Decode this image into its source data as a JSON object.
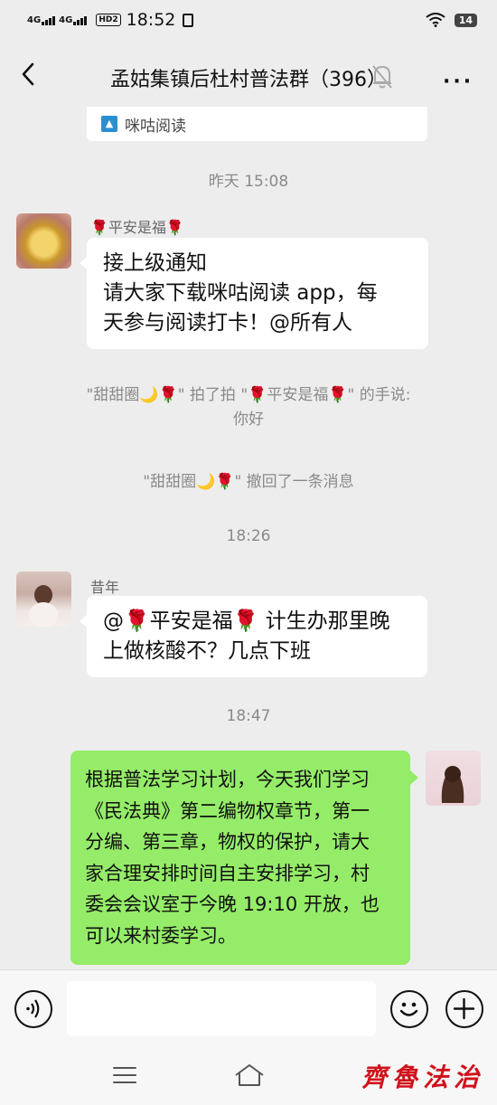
{
  "status_bar": {
    "signal1": "4G",
    "signal2": "4G",
    "hd": "HD2",
    "time": "18:52",
    "battery": "14"
  },
  "header": {
    "title": "孟姑集镇后杜村普法群（396）",
    "more": "···"
  },
  "shared_card": {
    "app_name": "咪咕阅读"
  },
  "timestamps": [
    "昨天 15:08",
    "18:26",
    "18:47"
  ],
  "messages": [
    {
      "sender": "🌹平安是福🌹",
      "text_lines": [
        "接上级通知",
        "请大家下载咪咕阅读 app，每",
        "天参与阅读打卡！@所有人"
      ]
    },
    {
      "sender": "昔年",
      "text_lines": [
        "@🌹平安是福🌹 计生办那里晚",
        "上做核酸不？几点下班"
      ]
    },
    {
      "sender": "me",
      "text_lines": [
        "根据普法学习计划，今天我们学习",
        "《民法典》第二编物权章节，第一",
        "分编、第三章，物权的保护，请大",
        "家合理安排时间自主安排学习，村",
        "委会会议室于今晚 19:10 开放，也",
        "可以来村委学习。"
      ]
    }
  ],
  "system_notices": [
    {
      "lines": [
        "\"甜甜圈🌙🌹\" 拍了拍 \"🌹平安是福🌹\" 的手说:",
        "你好"
      ]
    },
    {
      "lines": [
        "\"甜甜圈🌙🌹\" 撤回了一条消息"
      ]
    }
  ],
  "watermark": "齊魯法治",
  "colors": {
    "background": "#ededed",
    "my_bubble": "#95ec69",
    "their_bubble": "#ffffff",
    "timestamp": "#8a8a8a",
    "watermark": "#d0111b"
  },
  "icons": [
    "back-arrow-icon",
    "mute-bell-icon",
    "more-icon",
    "voice-icon",
    "emoji-icon",
    "plus-icon",
    "menu-icon",
    "home-icon"
  ]
}
